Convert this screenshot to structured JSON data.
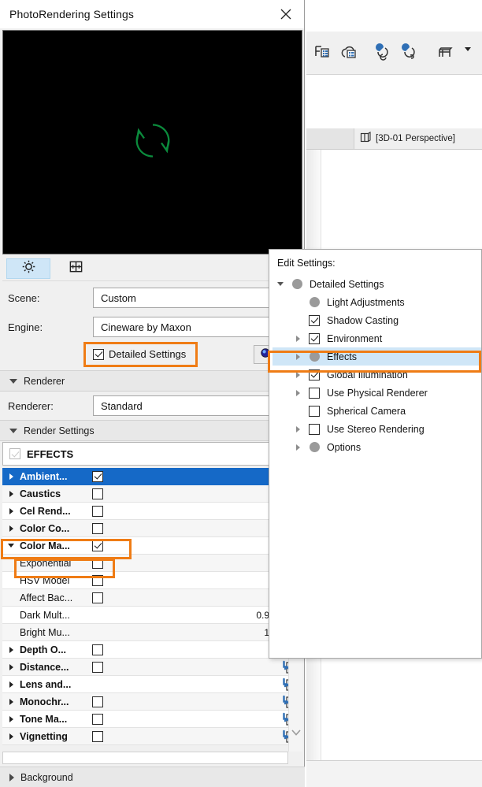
{
  "dialog": {
    "title": "PhotoRendering Settings",
    "close_icon": "close-icon",
    "preview_icon": "refresh-spinner-icon",
    "tabs": [
      {
        "icon": "gear-icon",
        "active": true
      },
      {
        "icon": "layout-frame-icon",
        "active": false
      }
    ],
    "scene": {
      "label": "Scene:",
      "value": "Custom"
    },
    "engine": {
      "label": "Engine:",
      "value": "Cineware by Maxon"
    },
    "detailed_settings": {
      "label": "Detailed Settings",
      "checked": true,
      "highlighted": true
    },
    "eye_button_icon": "preview-eye-icon",
    "renderer_section": {
      "label": "Renderer",
      "expanded": true
    },
    "renderer": {
      "label": "Renderer:",
      "value": "Standard"
    },
    "render_settings_section": {
      "label": "Render Settings",
      "expanded": true
    },
    "effects_header": {
      "label": "EFFECTS",
      "checked": true,
      "disabled": true,
      "button_icon": "tree-list-icon"
    },
    "effects": [
      {
        "name": "Ambient...",
        "expanded": false,
        "checkbox": true,
        "selected": true,
        "child": false,
        "value": null,
        "load_icon": false
      },
      {
        "name": "Caustics",
        "expanded": false,
        "checkbox": false,
        "selected": false,
        "child": false,
        "value": null,
        "load_icon": false
      },
      {
        "name": "Cel Rend...",
        "expanded": false,
        "checkbox": false,
        "selected": false,
        "child": false,
        "value": null,
        "load_icon": false
      },
      {
        "name": "Color Co...",
        "expanded": false,
        "checkbox": false,
        "selected": false,
        "child": false,
        "value": null,
        "load_icon": false
      },
      {
        "name": "Color Ma...",
        "expanded": true,
        "checkbox": true,
        "selected": false,
        "child": false,
        "value": null,
        "load_icon": false,
        "highlighted": true
      },
      {
        "name": "Exponential",
        "expanded": null,
        "checkbox": false,
        "selected": false,
        "child": true,
        "value": null,
        "load_icon": false,
        "highlighted": true
      },
      {
        "name": "HSV Model",
        "expanded": null,
        "checkbox": false,
        "selected": false,
        "child": true,
        "value": null,
        "load_icon": false
      },
      {
        "name": "Affect Bac...",
        "expanded": null,
        "checkbox": false,
        "selected": false,
        "child": true,
        "value": null,
        "load_icon": false
      },
      {
        "name": "Dark Mult...",
        "expanded": null,
        "checkbox": null,
        "selected": false,
        "child": true,
        "value": "0.9",
        "load_icon": false
      },
      {
        "name": "Bright Mu...",
        "expanded": null,
        "checkbox": null,
        "selected": false,
        "child": true,
        "value": "1",
        "load_icon": false
      },
      {
        "name": "Depth O...",
        "expanded": false,
        "checkbox": false,
        "selected": false,
        "child": false,
        "value": null,
        "load_icon": true
      },
      {
        "name": "Distance...",
        "expanded": false,
        "checkbox": false,
        "selected": false,
        "child": false,
        "value": null,
        "load_icon": true
      },
      {
        "name": "Lens and...",
        "expanded": false,
        "checkbox": null,
        "selected": false,
        "child": false,
        "value": null,
        "load_icon": true
      },
      {
        "name": "Monochr...",
        "expanded": false,
        "checkbox": false,
        "selected": false,
        "child": false,
        "value": null,
        "load_icon": true
      },
      {
        "name": "Tone Ma...",
        "expanded": false,
        "checkbox": false,
        "selected": false,
        "child": false,
        "value": null,
        "load_icon": true
      },
      {
        "name": "Vignetting",
        "expanded": false,
        "checkbox": false,
        "selected": false,
        "child": false,
        "value": null,
        "load_icon": true
      }
    ],
    "background_section": {
      "label": "Background",
      "expanded": false
    },
    "scroll_down_icon": "chevron-down-icon"
  },
  "popup": {
    "header": "Edit Settings:",
    "items": [
      {
        "label": "Detailed Settings",
        "indent": 0,
        "expander": "down",
        "marker": "dot",
        "highlighted": false
      },
      {
        "label": "Light Adjustments",
        "indent": 1,
        "expander": "none",
        "marker": "dot",
        "highlighted": false
      },
      {
        "label": "Shadow Casting",
        "indent": 1,
        "expander": "none",
        "marker": "check-on",
        "highlighted": false
      },
      {
        "label": "Environment",
        "indent": 1,
        "expander": "right",
        "marker": "check-on",
        "highlighted": false
      },
      {
        "label": "Effects",
        "indent": 1,
        "expander": "right",
        "marker": "dot",
        "highlighted": true
      },
      {
        "label": "Global Illumination",
        "indent": 1,
        "expander": "right",
        "marker": "check-on",
        "highlighted": false
      },
      {
        "label": "Use Physical Renderer",
        "indent": 1,
        "expander": "right",
        "marker": "check-off",
        "highlighted": false
      },
      {
        "label": "Spherical Camera",
        "indent": 1,
        "expander": "none",
        "marker": "check-off",
        "highlighted": false
      },
      {
        "label": "Use Stereo Rendering",
        "indent": 1,
        "expander": "right",
        "marker": "check-off",
        "highlighted": false
      },
      {
        "label": "Options",
        "indent": 1,
        "expander": "right",
        "marker": "dot",
        "highlighted": false
      }
    ]
  },
  "host": {
    "toolbar_icons": [
      "filter-list-icon",
      "cloud-list-icon",
      "render-region-icon",
      "render-settings-icon",
      "table-icon",
      "dropdown-caret-icon",
      "table-schedule-icon"
    ],
    "view_tab": {
      "label": "[3D-01 Perspective]",
      "icon": "view-3d-icon"
    }
  },
  "colors": {
    "highlight_orange": "#ef7c15",
    "selection_blue": "#1569c7",
    "popup_highlight": "#cfe6f7",
    "spinner_green": "#0b8a3c"
  }
}
